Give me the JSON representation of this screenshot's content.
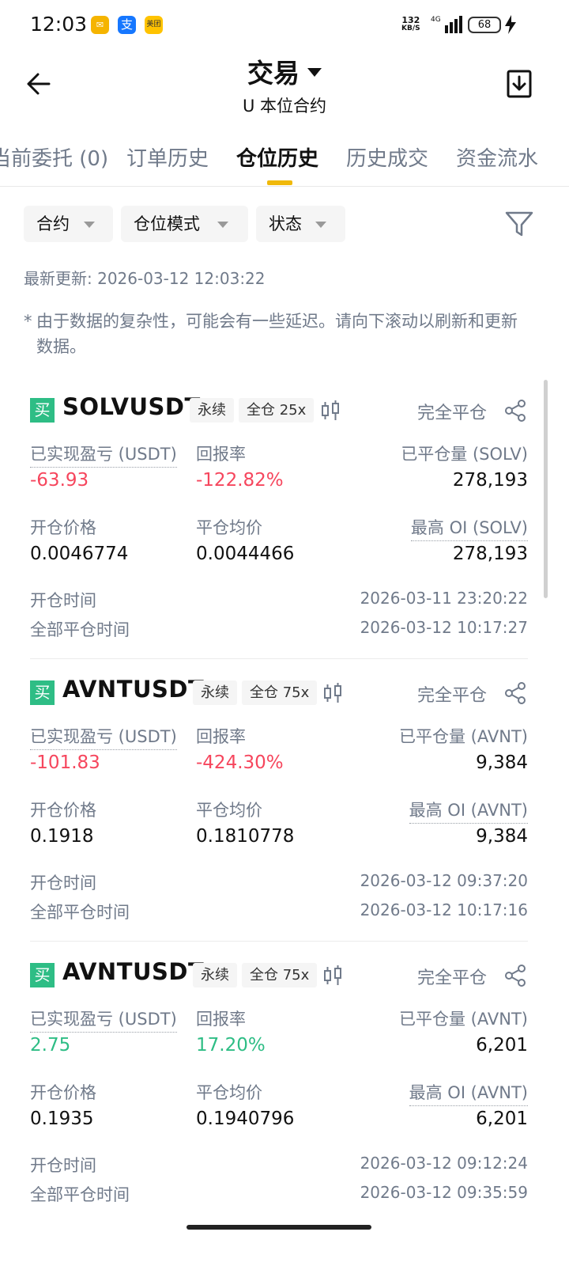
{
  "status_bar": {
    "time": "12:03",
    "app_icons": [
      {
        "name": "mail-app-icon",
        "glyph": "✉",
        "color": "#f5b400"
      },
      {
        "name": "alipay-app-icon",
        "glyph": "支",
        "color": "#1677ff"
      },
      {
        "name": "meituan-app-icon",
        "glyph": "美团",
        "color": "#ffc300"
      }
    ],
    "net_speed_value": "132",
    "net_speed_unit": "KB/S",
    "network": "4G",
    "battery": "68"
  },
  "header": {
    "title": "交易",
    "subtitle": "U 本位合约"
  },
  "tabs": [
    {
      "label": "当前委托 (0)",
      "active": false
    },
    {
      "label": "订单历史",
      "active": false
    },
    {
      "label": "仓位历史",
      "active": true
    },
    {
      "label": "历史成交",
      "active": false
    },
    {
      "label": "资金流水",
      "active": false
    }
  ],
  "filters": {
    "contract": "合约",
    "position_mode": "仓位模式",
    "status": "状态"
  },
  "last_update": "最新更新: 2026-03-12 12:03:22",
  "notice": {
    "star": "*",
    "text": "由于数据的复杂性，可能会有一些延迟。请向下滚动以刷新和更新数据。"
  },
  "positions": [
    {
      "side": "买",
      "symbol": "SOLVUSDT",
      "type_tag": "永续",
      "margin_tag": "全仓 25x",
      "status": "完全平仓",
      "pnl_label": "已实现盈亏 (USDT)",
      "pnl": "-63.93",
      "roi_label": "回报率",
      "roi": "-122.82%",
      "closed_qty_label": "已平仓量 (SOLV)",
      "closed_qty": "278,193",
      "open_price_label": "开仓价格",
      "open_price": "0.0046774",
      "close_avg_label": "平仓均价",
      "close_avg": "0.0044466",
      "max_oi_label": "最高 OI (SOLV)",
      "max_oi": "278,193",
      "open_time_label": "开仓时间",
      "open_time": "2026-03-11 23:20:22",
      "close_time_label": "全部平仓时间",
      "close_time": "2026-03-12 10:17:27"
    },
    {
      "side": "买",
      "symbol": "AVNTUSDT",
      "type_tag": "永续",
      "margin_tag": "全仓 75x",
      "status": "完全平仓",
      "pnl_label": "已实现盈亏 (USDT)",
      "pnl": "-101.83",
      "roi_label": "回报率",
      "roi": "-424.30%",
      "closed_qty_label": "已平仓量 (AVNT)",
      "closed_qty": "9,384",
      "open_price_label": "开仓价格",
      "open_price": "0.1918",
      "close_avg_label": "平仓均价",
      "close_avg": "0.1810778",
      "max_oi_label": "最高 OI (AVNT)",
      "max_oi": "9,384",
      "open_time_label": "开仓时间",
      "open_time": "2026-03-12 09:37:20",
      "close_time_label": "全部平仓时间",
      "close_time": "2026-03-12 10:17:16"
    },
    {
      "side": "买",
      "symbol": "AVNTUSDT",
      "type_tag": "永续",
      "margin_tag": "全仓 75x",
      "status": "完全平仓",
      "pnl_label": "已实现盈亏 (USDT)",
      "pnl": "2.75",
      "roi_label": "回报率",
      "roi": "17.20%",
      "closed_qty_label": "已平仓量 (AVNT)",
      "closed_qty": "6,201",
      "open_price_label": "开仓价格",
      "open_price": "0.1935",
      "close_avg_label": "平仓均价",
      "close_avg": "0.1940796",
      "max_oi_label": "最高 OI (AVNT)",
      "max_oi": "6,201",
      "open_time_label": "开仓时间",
      "open_time": "2026-03-12 09:12:24",
      "close_time_label": "全部平仓时间",
      "close_time": "2026-03-12 09:35:59"
    }
  ],
  "colors": {
    "accent": "#f0b90b",
    "buy": "#2ebd85",
    "loss": "#f6465d",
    "profit": "#2ebd85",
    "muted": "#707a8a"
  }
}
